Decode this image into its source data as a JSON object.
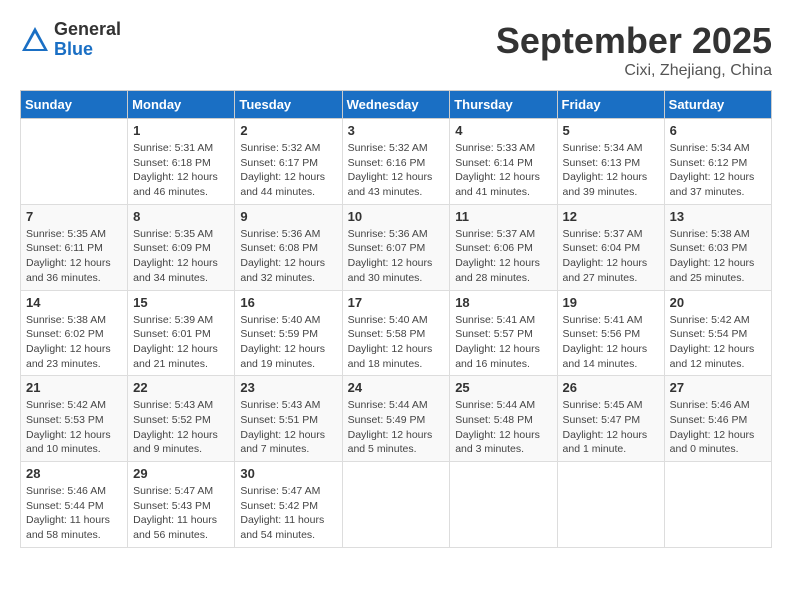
{
  "header": {
    "logo_general": "General",
    "logo_blue": "Blue",
    "month_title": "September 2025",
    "location": "Cixi, Zhejiang, China"
  },
  "weekdays": [
    "Sunday",
    "Monday",
    "Tuesday",
    "Wednesday",
    "Thursday",
    "Friday",
    "Saturday"
  ],
  "weeks": [
    [
      {
        "day": "",
        "info": ""
      },
      {
        "day": "1",
        "info": "Sunrise: 5:31 AM\nSunset: 6:18 PM\nDaylight: 12 hours\nand 46 minutes."
      },
      {
        "day": "2",
        "info": "Sunrise: 5:32 AM\nSunset: 6:17 PM\nDaylight: 12 hours\nand 44 minutes."
      },
      {
        "day": "3",
        "info": "Sunrise: 5:32 AM\nSunset: 6:16 PM\nDaylight: 12 hours\nand 43 minutes."
      },
      {
        "day": "4",
        "info": "Sunrise: 5:33 AM\nSunset: 6:14 PM\nDaylight: 12 hours\nand 41 minutes."
      },
      {
        "day": "5",
        "info": "Sunrise: 5:34 AM\nSunset: 6:13 PM\nDaylight: 12 hours\nand 39 minutes."
      },
      {
        "day": "6",
        "info": "Sunrise: 5:34 AM\nSunset: 6:12 PM\nDaylight: 12 hours\nand 37 minutes."
      }
    ],
    [
      {
        "day": "7",
        "info": "Sunrise: 5:35 AM\nSunset: 6:11 PM\nDaylight: 12 hours\nand 36 minutes."
      },
      {
        "day": "8",
        "info": "Sunrise: 5:35 AM\nSunset: 6:09 PM\nDaylight: 12 hours\nand 34 minutes."
      },
      {
        "day": "9",
        "info": "Sunrise: 5:36 AM\nSunset: 6:08 PM\nDaylight: 12 hours\nand 32 minutes."
      },
      {
        "day": "10",
        "info": "Sunrise: 5:36 AM\nSunset: 6:07 PM\nDaylight: 12 hours\nand 30 minutes."
      },
      {
        "day": "11",
        "info": "Sunrise: 5:37 AM\nSunset: 6:06 PM\nDaylight: 12 hours\nand 28 minutes."
      },
      {
        "day": "12",
        "info": "Sunrise: 5:37 AM\nSunset: 6:04 PM\nDaylight: 12 hours\nand 27 minutes."
      },
      {
        "day": "13",
        "info": "Sunrise: 5:38 AM\nSunset: 6:03 PM\nDaylight: 12 hours\nand 25 minutes."
      }
    ],
    [
      {
        "day": "14",
        "info": "Sunrise: 5:38 AM\nSunset: 6:02 PM\nDaylight: 12 hours\nand 23 minutes."
      },
      {
        "day": "15",
        "info": "Sunrise: 5:39 AM\nSunset: 6:01 PM\nDaylight: 12 hours\nand 21 minutes."
      },
      {
        "day": "16",
        "info": "Sunrise: 5:40 AM\nSunset: 5:59 PM\nDaylight: 12 hours\nand 19 minutes."
      },
      {
        "day": "17",
        "info": "Sunrise: 5:40 AM\nSunset: 5:58 PM\nDaylight: 12 hours\nand 18 minutes."
      },
      {
        "day": "18",
        "info": "Sunrise: 5:41 AM\nSunset: 5:57 PM\nDaylight: 12 hours\nand 16 minutes."
      },
      {
        "day": "19",
        "info": "Sunrise: 5:41 AM\nSunset: 5:56 PM\nDaylight: 12 hours\nand 14 minutes."
      },
      {
        "day": "20",
        "info": "Sunrise: 5:42 AM\nSunset: 5:54 PM\nDaylight: 12 hours\nand 12 minutes."
      }
    ],
    [
      {
        "day": "21",
        "info": "Sunrise: 5:42 AM\nSunset: 5:53 PM\nDaylight: 12 hours\nand 10 minutes."
      },
      {
        "day": "22",
        "info": "Sunrise: 5:43 AM\nSunset: 5:52 PM\nDaylight: 12 hours\nand 9 minutes."
      },
      {
        "day": "23",
        "info": "Sunrise: 5:43 AM\nSunset: 5:51 PM\nDaylight: 12 hours\nand 7 minutes."
      },
      {
        "day": "24",
        "info": "Sunrise: 5:44 AM\nSunset: 5:49 PM\nDaylight: 12 hours\nand 5 minutes."
      },
      {
        "day": "25",
        "info": "Sunrise: 5:44 AM\nSunset: 5:48 PM\nDaylight: 12 hours\nand 3 minutes."
      },
      {
        "day": "26",
        "info": "Sunrise: 5:45 AM\nSunset: 5:47 PM\nDaylight: 12 hours\nand 1 minute."
      },
      {
        "day": "27",
        "info": "Sunrise: 5:46 AM\nSunset: 5:46 PM\nDaylight: 12 hours\nand 0 minutes."
      }
    ],
    [
      {
        "day": "28",
        "info": "Sunrise: 5:46 AM\nSunset: 5:44 PM\nDaylight: 11 hours\nand 58 minutes."
      },
      {
        "day": "29",
        "info": "Sunrise: 5:47 AM\nSunset: 5:43 PM\nDaylight: 11 hours\nand 56 minutes."
      },
      {
        "day": "30",
        "info": "Sunrise: 5:47 AM\nSunset: 5:42 PM\nDaylight: 11 hours\nand 54 minutes."
      },
      {
        "day": "",
        "info": ""
      },
      {
        "day": "",
        "info": ""
      },
      {
        "day": "",
        "info": ""
      },
      {
        "day": "",
        "info": ""
      }
    ]
  ]
}
